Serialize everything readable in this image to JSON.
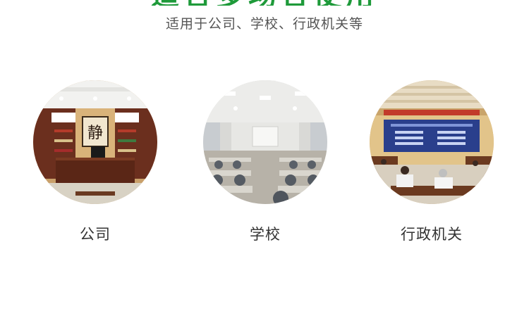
{
  "header": {
    "headline": "适合多场合使用",
    "subtitle": "适用于公司、学校、行政机关等"
  },
  "venues": [
    {
      "label": "公司",
      "image": "office-photo"
    },
    {
      "label": "学校",
      "image": "classroom-photo"
    },
    {
      "label": "行政机关",
      "image": "conference-room-photo"
    }
  ],
  "company_photo": {
    "calligraphy": "静"
  },
  "colors": {
    "headline": "#1e9a3a",
    "subtitle": "#555555",
    "label": "#333333"
  }
}
